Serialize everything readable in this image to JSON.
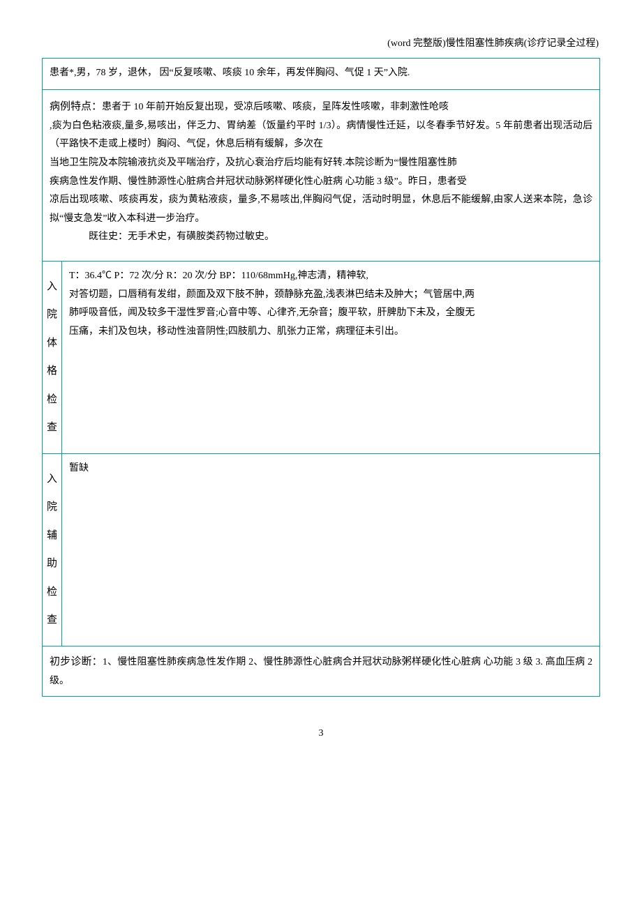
{
  "header": "(word 完整版)慢性阻塞性肺疾病(诊疗记录全过程)",
  "intro": "患者*,男，78 岁，退休，  因“反复咳嗽、咳痰 10 余年，再发伴胸闷、气促 1 天”入院.",
  "case": {
    "title": "病例特点：",
    "p1": "患者于 10 年前开始反复出现，受凉后咳嗽、咳痰，呈阵发性咳嗽，非刺激性呛咳",
    "p2": ",痰为白色粘液痰,量多,易咳出，伴乏力、胃纳差（饭量约平时 1/3）。病情慢性迁延，以冬春季节好发。5 年前患者出现活动后（平路快不走或上楼时）胸闷、气促，休息后稍有缓解，多次在",
    "p3": "当地卫生院及本院输液抗炎及平喘治疗，及抗心衰治疗后均能有好转.本院诊断为“慢性阻塞性肺",
    "p4": "疾病急性发作期、慢性肺源性心脏病合并冠状动脉粥样硬化性心脏病 心功能 3 级”。昨日，患者受",
    "p5": "凉后出现咳嗽、咳痰再发，痰为黄粘液痰，量多,不易咳出,伴胸闷气促，活动时明显，休息后不能缓解,由家人送来本院，急诊拟“慢支急发”收入本科进一步治疗。",
    "p6": "既往史：无手术史，有磺胺类药物过敏史。"
  },
  "exam_label_chars": [
    "入",
    "院",
    "体",
    "格",
    "检",
    "查"
  ],
  "exam": {
    "l1": "T：36.4℃ P：72 次/分 R：20 次/分 BP：110/68mmHg,神志清，精神软,",
    "l2": "对答切题，口唇稍有发绀，颜面及双下肢不肿，颈静脉充盈,浅表淋巴结未及肿大；气管居中,两",
    "l3": "肺呼吸音低，闻及较多干湿性罗音;心音中等、心律齐,无杂音；腹平软，肝脾肋下未及，全腹无",
    "l4": "压痛，未扪及包块，移动性浊音阴性;四肢肌力、肌张力正常，病理征未引出。"
  },
  "aux_label_chars": [
    "入",
    "院",
    "辅",
    "助",
    "检",
    "查"
  ],
  "aux": "暂缺",
  "diag": {
    "title": "初步诊断：",
    "text": "1、慢性阻塞性肺疾病急性发作期 2、慢性肺源性心脏病合并冠状动脉粥样硬化性心脏病 心功能 3 级  3. 高血压病 2 级。"
  },
  "page_number": "3"
}
